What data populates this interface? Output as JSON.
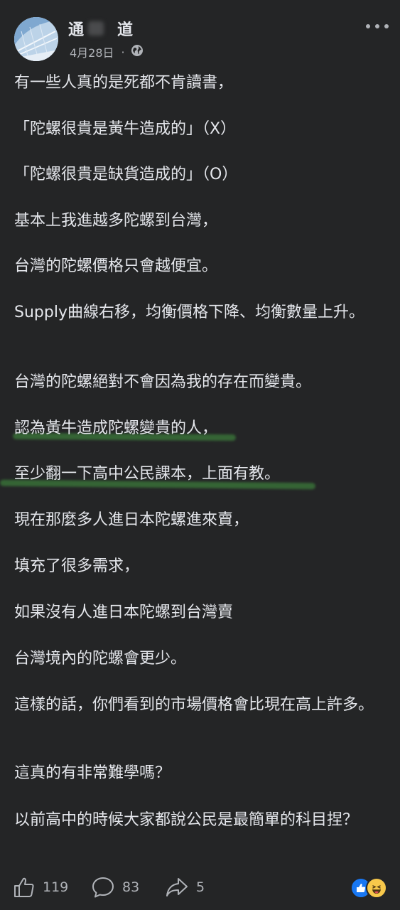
{
  "post": {
    "author": "通　　道",
    "date": "4月28日",
    "separator": "·",
    "audience_icon": "globe-icon",
    "paragraphs": [
      "有一些人真的是死都不肯讀書，",
      "「陀螺很貴是黃牛造成的」（X）",
      "「陀螺很貴是缺貨造成的」（O）",
      "基本上我進越多陀螺到台灣，",
      "台灣的陀螺價格只會越便宜。",
      "Supply曲線右移，均衡價格下降、均衡數量上升。",
      "台灣的陀螺絕對不會因為我的存在而變貴。",
      "認為黃牛造成陀螺變貴的人，",
      "至少翻一下高中公民課本，上面有教。",
      "現在那麼多人進日本陀螺進來賣，",
      "填充了很多需求，",
      "如果沒有人進日本陀螺到台灣賣",
      "台灣境內的陀螺會更少。",
      "這樣的話，你們看到的市場價格會比現在高上許多。",
      "這真的有非常難學嗎？",
      "以前高中的時候大家都說公民是最簡單的科目捏？"
    ]
  },
  "footer": {
    "likes": "119",
    "comments": "83",
    "shares": "5",
    "reaction_icons": [
      "like-icon",
      "haha-icon"
    ]
  },
  "colors": {
    "background": "#242526",
    "text": "#e4e6eb",
    "secondary": "#b0b3b8",
    "highlight": "#3b7a3a",
    "like_blue": "#1877f2",
    "haha_yellow": "#f7c84b"
  }
}
